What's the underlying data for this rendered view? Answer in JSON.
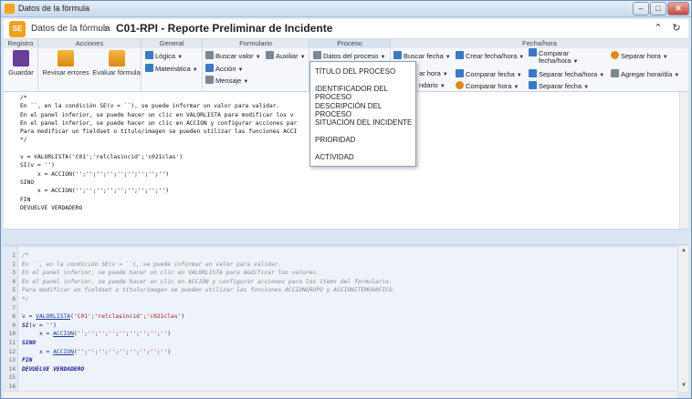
{
  "window": {
    "title": "Datos de la fórmula",
    "min_label": "–",
    "max_label": "□",
    "close_label": "✕"
  },
  "header": {
    "logo_text": "SE",
    "breadcrumb": "Datos de la fórmula",
    "separator": "›",
    "doc_title": "C01-RPI - Reporte Preliminar de Incidente",
    "collapse_icon": "⌃",
    "refresh_icon": "↻"
  },
  "ribbon": {
    "groups": {
      "registro": "Registro",
      "acciones": "Acciones",
      "general": "General",
      "formulario": "Formulario",
      "proceso": "Proceso",
      "fechahora": "Fecha/hora"
    },
    "guardar": "Guardar",
    "revisar": "Revisar errores",
    "evaluar": "Evaluar fórmula",
    "logica": "Lógica",
    "matematica": "Matemática",
    "buscar_valor": "Buscar valor",
    "auxiliar": "Auxiliar",
    "accion": "Acción",
    "mensaje": "Mensaje",
    "datos_proceso": "Datos del proceso",
    "buscar_fecha": "Buscar fecha",
    "crear_fecha": "Crear fecha/hora",
    "comparar_fecha_hora_top": "Comparar",
    "comparar_fecha_hora_bot": "fecha/hora",
    "separar_hora": "Separar hora",
    "partial_hora": "ar hora",
    "comparar_fecha": "Comparar fecha",
    "separar_fechahora": "Separar fecha/hora",
    "agregar_horadia": "Agregar hora/día",
    "partial_endario": "ndario",
    "comparar_hora": "Comparar hora",
    "separar_fecha": "Separar fecha"
  },
  "menu": {
    "items": [
      "TÍTULO DEL PROCESO",
      "IDENTIFICADOR DEL PROCESO",
      "DESCRIPCIÓN DEL PROCESO",
      "SITUACIÓN DEL INCIDENTE",
      "PRIORIDAD",
      "ACTIVIDAD"
    ]
  },
  "editor_top": {
    "text": "/*\nEn ``, en la condición SE(v = ``), se puede informar un valor para validar.\nEn el panel inferior, se puede hacer un clic en VALORLISTA para modificar los v\nEn el panel inferior, se puede hacer un clic en ACCION y configurar acciones par\nPara modificar un fieldset o título/imagen se pueden utilizar las funciones ACCI\n*/\n\nv = VALORLISTA('C01';'relclasincid';'c021clas')\nSI(v = '')\n     x = ACCION('';'';'';'';'';'';'';'';'')\nSINO\n     x = ACCION('';'';'';'';'';'';'';'';'')\nFIN\nDEVUELVE VERDADERO"
  },
  "editor_bottom": {
    "line_numbers": "1\n2\n3\n4\n5\n6\n7\n8\n9\n10\n11\n12\n13\n14\n15\n16",
    "comment_open": "/*",
    "comment_2": "En ``, en la condición SE(v = ``), se puede informar un valor para validar.",
    "comment_3": "En el panel inferior, se puede hacer un clic en VALORLISTA para modificar los valores.",
    "comment_4": "En el panel inferior, se puede hacer un clic en ACCION y configurar acciones para los ítems del formulario.",
    "comment_5": "Para modificar un fieldset o título/imagen se pueden utilizar las funciones ACCIONGRUPO y ACCIONITEMGRAFICO.",
    "comment_close": "*/",
    "l8_a": "v = ",
    "l8_fn": "VALORLISTA",
    "l8_b": "(",
    "l8_s": "'C01';'relclasincid';'c021clas'",
    "l8_c": ")",
    "l9_kw": "SI",
    "l9_b": "(v = ",
    "l9_s": "''",
    "l9_c": ")",
    "l10_a": "     x = ",
    "l10_fn": "ACCION",
    "l10_b": "(",
    "l10_s": "'';'';'';'';'';'';'';'';''",
    "l10_c": ")",
    "l11_kw": "SINO",
    "l12_a": "     x = ",
    "l12_fn": "ACCION",
    "l12_b": "(",
    "l12_s": "'';'';'';'';'';'';'';'';''",
    "l12_c": ")",
    "l13_kw": "FIN",
    "l14_kw": "DEVUELVE VERDADERO"
  }
}
